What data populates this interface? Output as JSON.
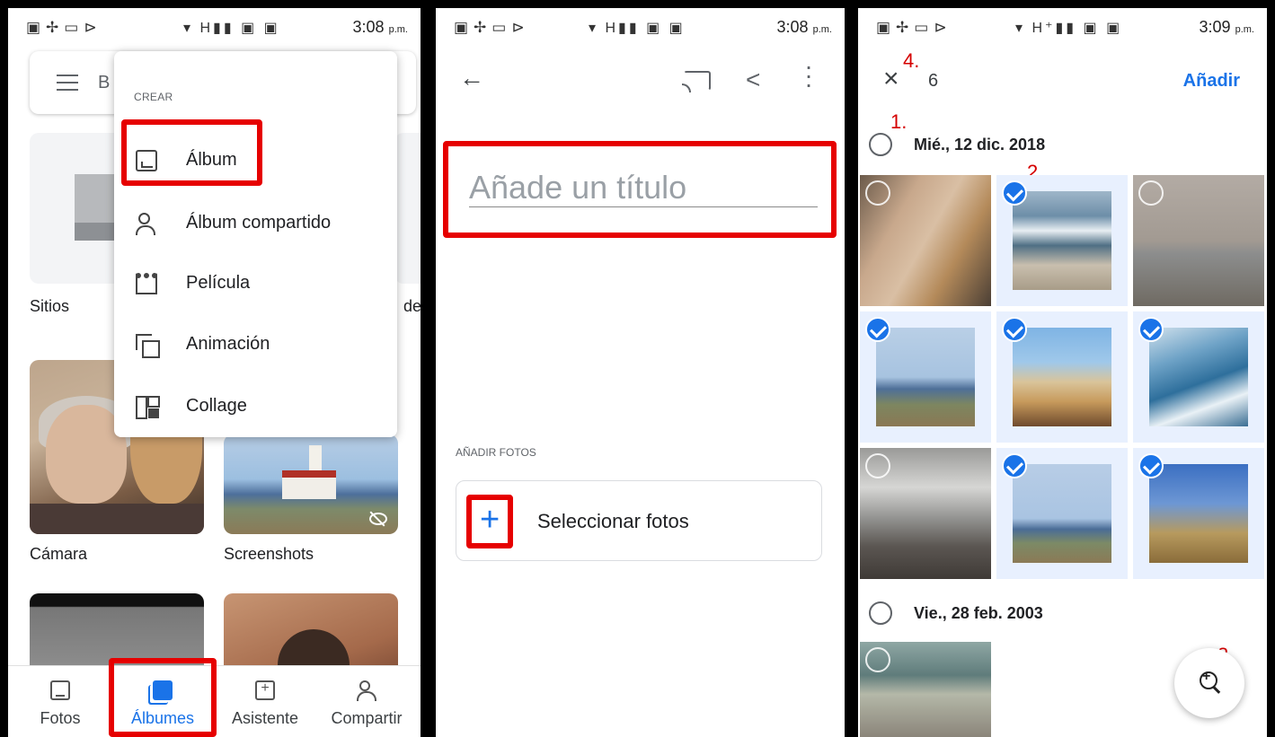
{
  "status_bars": [
    {
      "time": "3:08",
      "ampm": "p.m.",
      "signal": "H"
    },
    {
      "time": "3:08",
      "ampm": "p.m.",
      "signal": "H"
    },
    {
      "time": "3:09",
      "ampm": "p.m.",
      "signal": "H⁺"
    }
  ],
  "screen1": {
    "search_partial": "B",
    "create_menu": {
      "header": "CREAR",
      "items": [
        {
          "label": "Álbum",
          "icon": "album-icon"
        },
        {
          "label": "Álbum compartido",
          "icon": "shared-album-icon"
        },
        {
          "label": "Película",
          "icon": "movie-icon"
        },
        {
          "label": "Animación",
          "icon": "animation-icon"
        },
        {
          "label": "Collage",
          "icon": "collage-icon"
        }
      ]
    },
    "albums": [
      {
        "label": "Sitios"
      },
      {
        "label": "Cámara"
      },
      {
        "label": "Screenshots"
      }
    ],
    "right_partial_label": "dec",
    "bottom_nav": [
      {
        "label": "Fotos",
        "icon": "photos-icon"
      },
      {
        "label": "Álbumes",
        "icon": "albums-icon",
        "active": true
      },
      {
        "label": "Asistente",
        "icon": "assistant-icon"
      },
      {
        "label": "Compartir",
        "icon": "share-people-icon"
      }
    ]
  },
  "screen2": {
    "title_placeholder": "Añade un título",
    "add_photos_header": "AÑADIR FOTOS",
    "select_photos_label": "Seleccionar fotos",
    "plus_symbol": "+"
  },
  "screen3": {
    "selected_count": "6",
    "add_button": "Añadir",
    "date_groups": [
      {
        "date": "Mié., 12 dic. 2018"
      },
      {
        "date": "Vie., 28 feb. 2003"
      }
    ],
    "photos": [
      {
        "subject": "two-women",
        "selected": false
      },
      {
        "subject": "beach-waves",
        "selected": true
      },
      {
        "subject": "sea-lion-statue",
        "selected": false
      },
      {
        "subject": "lighthouse",
        "selected": true
      },
      {
        "subject": "tripod-beach",
        "selected": true
      },
      {
        "subject": "crashing-waves",
        "selected": true
      },
      {
        "subject": "heron",
        "selected": false
      },
      {
        "subject": "lighthouse-distant",
        "selected": true
      },
      {
        "subject": "dog-grass",
        "selected": true
      },
      {
        "subject": "beach-walkers",
        "selected": false
      }
    ],
    "annotations": [
      "1.",
      "2.",
      "3.",
      "4."
    ]
  },
  "colors": {
    "accent": "#1a73e8",
    "highlight_box": "#e60000",
    "annotation": "#d50000",
    "selected_bg": "#e8f0fe"
  }
}
